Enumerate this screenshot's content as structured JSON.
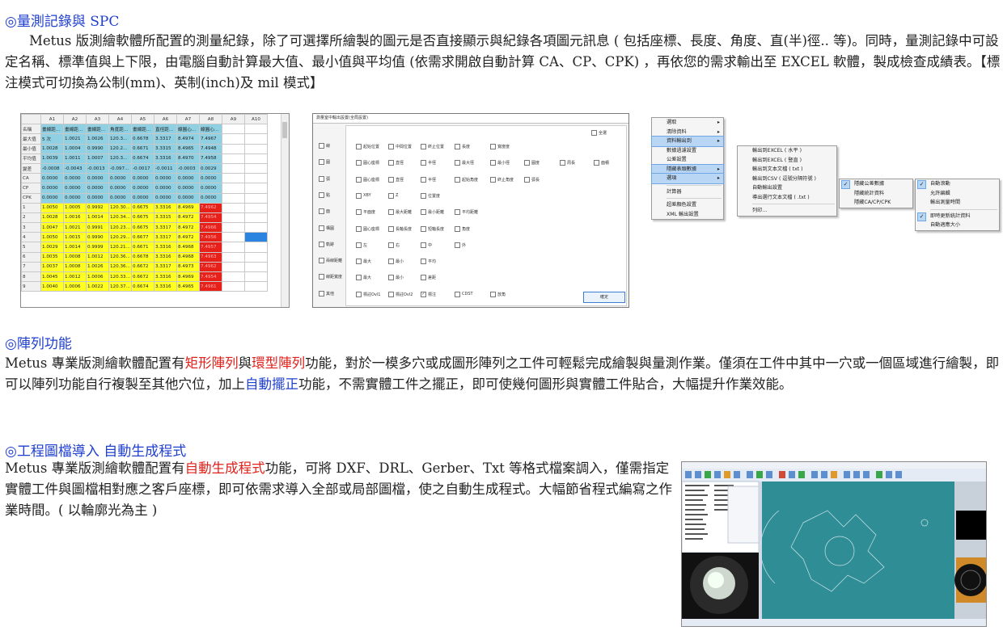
{
  "sections": {
    "spc": {
      "heading": "◎量測記錄與 SPC",
      "paragraph": "Metus 版測繪軟體所配置的測量紀錄，除了可選擇所繪製的圖元是否直接顯示與紀錄各項圖元訊息 ( 包括座標、長度、角度、直(半)徑.. 等)。同時，量測記錄中可設定名稱、標準值與上下限，由電腦自動計算最大值、最小值與平均值 (依需求開啟自動計算 CA、CP、CPK) ，再依您的需求輸出至 EXCEL 軟體，製成檢查成績表。【標注模式可切換為公制(mm)、英制(inch)及 mil 模式】"
    },
    "array": {
      "heading": "◎陣列功能",
      "p_pre": "Metus 專業版測繪軟體配置有",
      "p_rect": "矩形陣列",
      "p_and": "與",
      "p_ring": "環型陣列",
      "p_mid": "功能，對於一模多穴或成圖形陣列之工件可輕鬆完成繪製與量測作業。僅須在工件中其中一穴或一個區域進行繪製，即可以陣列功能自行複製至其他穴位，加上",
      "p_auto": "自動擺正",
      "p_post": "功能，不需實體工件之擺正，即可使幾何圖形與實體工件貼合，大幅提升作業效能。"
    },
    "import": {
      "heading": "◎工程圖檔導入  自動生成程式",
      "p_pre": "Metus 專業版測繪軟體配置有",
      "p_red": "自動生成程式",
      "p_post": "功能，可將 DXF、DRL、Gerber、Txt 等格式檔案調入，僅需指定實體工件與圖檔相對應之客戶座標，即可依需求導入全部或局部圖檔，使之自動生成程式。大幅節省程式編寫之作業時間。( 以輪廓光為主 )"
    }
  },
  "spc_table": {
    "columns": [
      "",
      "A1",
      "A2",
      "A3",
      "A4",
      "A5",
      "A6",
      "A7",
      "A8",
      "A9",
      "A10"
    ],
    "stat_rows": [
      [
        "名稱",
        "畫線距...",
        "畫線距...",
        "畫線距...",
        "角度距...",
        "畫線距...",
        "直徑距...",
        "線圓心...",
        "線圓心..."
      ],
      [
        "最大值",
        "5 次",
        "1.0021",
        "1.0026",
        "120.3...",
        "0.6678",
        "3.3317",
        "8.4974",
        "7.4967"
      ],
      [
        "最小值",
        "1.0028",
        "1.0004",
        "0.9990",
        "120.2...",
        "0.6671",
        "3.3315",
        "8.4965",
        "7.4948"
      ],
      [
        "平均值",
        "1.0039",
        "1.0011",
        "1.0007",
        "120.3...",
        "0.6674",
        "3.3316",
        "8.4970",
        "7.4958"
      ],
      [
        "變差",
        "-0.0008",
        "-0.0043",
        "-0.0013",
        "-0.097...",
        "-0.0017",
        "-0.0011",
        "-0.0003",
        "0.0029"
      ],
      [
        "CA",
        "0.0000",
        "0.0000",
        "0.0000",
        "0.0000",
        "0.0000",
        "0.0000",
        "0.0000",
        "0.0000"
      ],
      [
        "CP",
        "0.0000",
        "0.0000",
        "0.0000",
        "0.0000",
        "0.0000",
        "0.0000",
        "0.0000",
        "0.0000"
      ],
      [
        "CPK",
        "0.0000",
        "0.0000",
        "0.0000",
        "0.0000",
        "0.0000",
        "0.0000",
        "0.0000",
        "0.0000"
      ]
    ],
    "meas_rows": [
      [
        "1",
        "1.0050",
        "1.0005",
        "0.9992",
        "120.30...",
        "0.6675",
        "3.3316",
        "8.4969",
        "7.4962"
      ],
      [
        "2",
        "1.0028",
        "1.0016",
        "1.0014",
        "120.34...",
        "0.6675",
        "3.3315",
        "8.4972",
        "7.4954"
      ],
      [
        "3",
        "1.0047",
        "1.0021",
        "0.9991",
        "120.23...",
        "0.6675",
        "3.3317",
        "8.4972",
        "7.4966"
      ],
      [
        "4",
        "1.0050",
        "1.0015",
        "0.9990",
        "120.29...",
        "0.6677",
        "3.3317",
        "8.4972",
        "7.4956"
      ],
      [
        "5",
        "1.0029",
        "1.0014",
        "0.9999",
        "120.21...",
        "0.6671",
        "3.3316",
        "8.4968",
        "7.4957"
      ],
      [
        "6",
        "1.0035",
        "1.0008",
        "1.0012",
        "120.36...",
        "0.6678",
        "3.3316",
        "8.4968",
        "7.4963"
      ],
      [
        "7",
        "1.0037",
        "1.0008",
        "1.0026",
        "120.36...",
        "0.6672",
        "3.3317",
        "8.4973",
        "7.4962"
      ],
      [
        "8",
        "1.0045",
        "1.0012",
        "1.0006",
        "120.33...",
        "0.6672",
        "3.3316",
        "8.4969",
        "7.4954"
      ],
      [
        "9",
        "1.0040",
        "1.0006",
        "1.0022",
        "120.37...",
        "0.6674",
        "3.3316",
        "8.4965",
        "7.4961"
      ]
    ],
    "colors": {
      "stat": "#8fd0e3",
      "measure": "#ffff22",
      "out_of_range": "#e8201a",
      "selected": "#2a84e0"
    }
  },
  "output_dialog": {
    "title": "測量室中輸出設置(全局設置)",
    "select_all": "全選",
    "ok": "確定",
    "categories": [
      "線",
      "圓",
      "弧",
      "點",
      "面",
      "構圓",
      "軌跡",
      "兩線距離",
      "線距寬度",
      "其他"
    ],
    "rows": [
      [
        "起始位置",
        "中間位置",
        "終止位置",
        "長度",
        "寬度度"
      ],
      [
        "圓心座標",
        "直徑",
        "半徑",
        "最大徑",
        "最小徑",
        "圓度",
        "周長",
        "面積"
      ],
      [
        "圓心座標",
        "直徑",
        "半徑",
        "起始角度",
        "終止角度",
        "弧長"
      ],
      [
        "XBY",
        "Z",
        "位置度"
      ],
      [
        "平面度",
        "最大距離",
        "最小距離",
        "平均距離"
      ],
      [
        "圓心座標",
        "長軸長度",
        "短軸長度",
        "角度"
      ],
      [
        "左",
        "右",
        "中",
        "外"
      ],
      [
        "最大",
        "最小",
        "平均"
      ],
      [
        "最大",
        "最小",
        "差距"
      ],
      [
        "標註Ovl1",
        "標註Ovl2",
        "標注",
        "CDST",
        "放角"
      ]
    ],
    "checked": [
      [
        9,
        2
      ]
    ]
  },
  "context_menu": {
    "main": [
      "選取",
      "清除資料",
      "資料輸出到",
      "數據過濾設置",
      "公差設置",
      "隱藏表頭數據",
      "選項",
      "計算器",
      "超差顏色設置",
      "XML 輸出設置"
    ],
    "main_submenu": [
      true,
      true,
      true,
      false,
      false,
      true,
      true,
      false,
      false,
      false
    ],
    "main_highlight": [
      2,
      5,
      6
    ],
    "export_submenu": [
      "輸出到EXCEL ( 水平 )",
      "輸出到EXCEL ( 豎直 )",
      "輸出到文本文檔 ( txt )",
      "輸出到CSV ( 逗號分隔符號 )",
      "自動輸出設置",
      "導出選行文本文檔 ( .txt )",
      "列印..."
    ],
    "hide_submenu": [
      "隱藏公差數據",
      "隱藏統計資料",
      "隱藏CA/CP/CPK"
    ],
    "options_submenu": [
      "自動滾動",
      "允許編輯",
      "輸出測量時間",
      "即時更新統計資料",
      "自動適應大小"
    ],
    "hide_checked": [
      0
    ],
    "options_checked": [
      0,
      3
    ]
  },
  "cad_screenshot": {
    "description_visible": false
  }
}
